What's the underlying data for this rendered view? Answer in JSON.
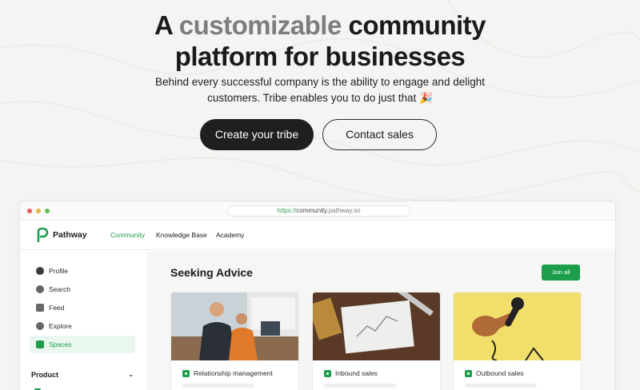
{
  "hero": {
    "title_part1": "A ",
    "title_accent": "customizable",
    "title_part2": " community",
    "title_line2": "platform for businesses",
    "subtitle_line1": "Behind every successful company is the ability to engage and delight",
    "subtitle_line2": "customers. Tribe enables you to do just that 🎉",
    "primary_cta": "Create your tribe",
    "secondary_cta": "Contact sales"
  },
  "browser": {
    "url_proto": "https://",
    "url_host": "community",
    "url_rest": ".pathway.so"
  },
  "app": {
    "brand": "Pathway",
    "nav": [
      "Community",
      "Knowledge Base",
      "Academy"
    ],
    "sidebar": [
      {
        "label": "Profile",
        "icon": "avatar-icon"
      },
      {
        "label": "Search",
        "icon": "search-icon"
      },
      {
        "label": "Feed",
        "icon": "feed-icon"
      },
      {
        "label": "Explore",
        "icon": "compass-icon"
      },
      {
        "label": "Spaces",
        "icon": "spaces-icon",
        "active": true
      }
    ],
    "sidebar_section": "Product",
    "main_title": "Seeking Advice",
    "join_label": "Join all",
    "cards": [
      {
        "label": "Relationship management"
      },
      {
        "label": "Inbound sales"
      },
      {
        "label": "Outbound sales"
      }
    ]
  },
  "colors": {
    "accent": "#1b9d4a",
    "background": "#f4f4f2",
    "dark_button": "#1f1f1f"
  }
}
